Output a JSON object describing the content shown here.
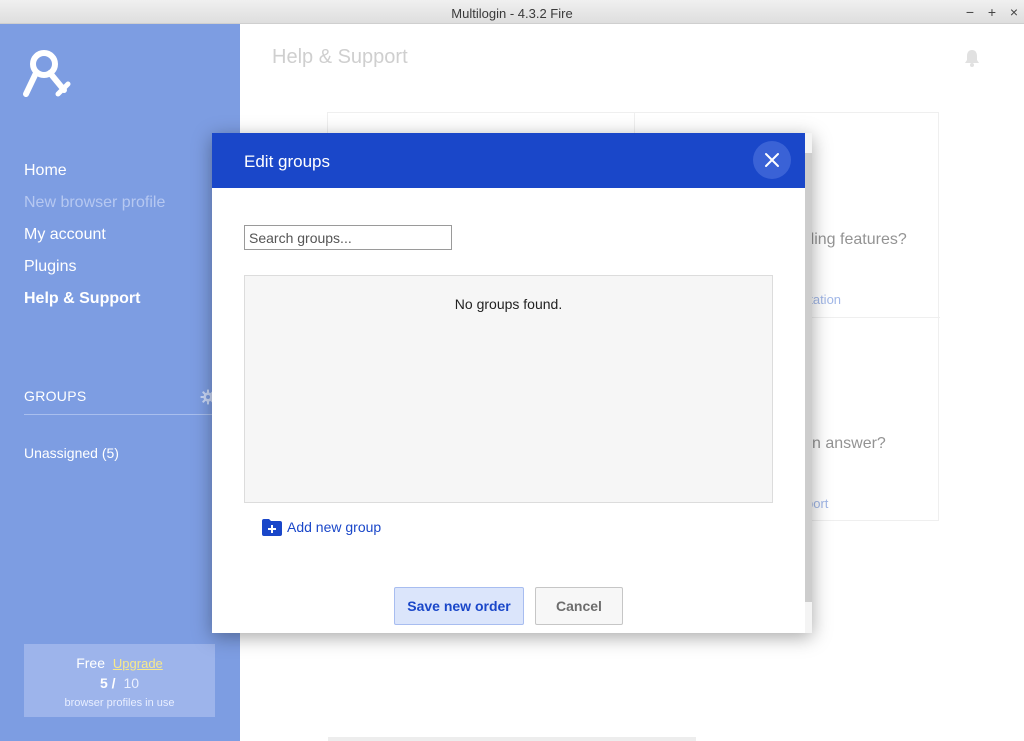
{
  "window": {
    "title": "Multilogin - 4.3.2 Fire",
    "minimize": "−",
    "maximize": "+",
    "close": "×"
  },
  "sidebar": {
    "nav": [
      {
        "label": "Home",
        "state": "normal"
      },
      {
        "label": "New browser profile",
        "state": "disabled"
      },
      {
        "label": "My account",
        "state": "normal"
      },
      {
        "label": "Plugins",
        "state": "normal"
      },
      {
        "label": "Help & Support",
        "state": "active"
      }
    ],
    "groups_heading": "GROUPS",
    "groups": [
      {
        "label": "Unassigned (5)"
      }
    ],
    "plan": {
      "name": "Free",
      "upgrade_label": "Upgrade",
      "used": "5 /",
      "total": "10",
      "caption": "browser profiles in use"
    }
  },
  "main": {
    "page_title": "Help & Support",
    "cards": [
      {
        "question": "rding features?",
        "link": "ntation"
      },
      {
        "question": "n answer?",
        "link": "port"
      }
    ]
  },
  "modal": {
    "title": "Edit groups",
    "search_placeholder": "Search groups...",
    "empty_text": "No groups found.",
    "add_group_label": "Add new group",
    "save_label": "Save new order",
    "cancel_label": "Cancel"
  },
  "colors": {
    "sidebar": "#7d9de2",
    "modal_header": "#1a47c9",
    "accent": "#1a47c9",
    "upgrade_link": "#f7e98a"
  }
}
